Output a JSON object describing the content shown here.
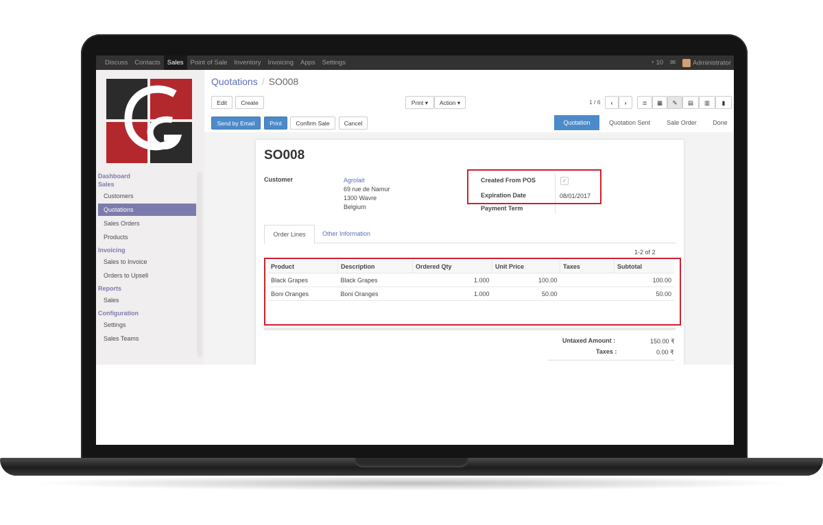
{
  "topbar": {
    "menu": [
      "Discuss",
      "Contacts",
      "Sales",
      "Point of Sale",
      "Inventory",
      "Invoicing",
      "Apps",
      "Settings"
    ],
    "active": "Sales",
    "notif_count": "10",
    "user": "Administrator"
  },
  "sidebar": {
    "sections": [
      {
        "head": "Dashboard",
        "items": []
      },
      {
        "head": "Sales",
        "items": [
          "Customers",
          "Quotations",
          "Sales Orders",
          "Products"
        ]
      },
      {
        "head": "Invoicing",
        "items": [
          "Sales to Invoice",
          "Orders to Upsell"
        ]
      },
      {
        "head": "Reports",
        "items": [
          "Sales"
        ]
      },
      {
        "head": "Configuration",
        "items": [
          "Settings",
          "Sales Teams"
        ]
      }
    ],
    "active_item": "Quotations"
  },
  "breadcrumb": {
    "parent": "Quotations",
    "separator": "/",
    "current": "SO008"
  },
  "toolbar": {
    "edit": "Edit",
    "create": "Create",
    "print": "Print",
    "action": "Action",
    "pager": "1 / 6"
  },
  "actions": {
    "send_email": "Send by Email",
    "print": "Print",
    "confirm": "Confirm Sale",
    "cancel": "Cancel"
  },
  "stages": [
    "Quotation",
    "Quotation Sent",
    "Sale Order",
    "Done"
  ],
  "current_stage": "Quotation",
  "record": {
    "name": "SO008",
    "customer_label": "Customer",
    "customer_name": "Agrolait",
    "address": [
      "69 rue de Namur",
      "1300 Wavre",
      "Belgium"
    ],
    "created_from_pos_label": "Created From POS",
    "created_from_pos": true,
    "expiration_label": "Expiration Date",
    "expiration_date": "08/01/2017",
    "payment_term_label": "Payment Term"
  },
  "tabs": [
    "Order Lines",
    "Other Information"
  ],
  "lines_count": "1-2 of 2",
  "order_lines": {
    "columns": [
      "Product",
      "Description",
      "Ordered Qty",
      "Unit Price",
      "Taxes",
      "Subtotal"
    ],
    "rows": [
      [
        "Black Grapes",
        "Black Grapes",
        "1.000",
        "100.00",
        "",
        "100.00"
      ],
      [
        "Boni Oranges",
        "Boni Oranges",
        "1.000",
        "50.00",
        "",
        "50.00"
      ]
    ]
  },
  "totals": {
    "untaxed_label": "Untaxed Amount :",
    "untaxed": "150.00 ₹",
    "taxes_label": "Taxes :",
    "taxes": "0.00 ₹"
  },
  "colors": {
    "accent": "#7c7bad",
    "primary": "#4c8ac9",
    "highlight": "#d21e2b",
    "logo_red": "#b3282d"
  }
}
